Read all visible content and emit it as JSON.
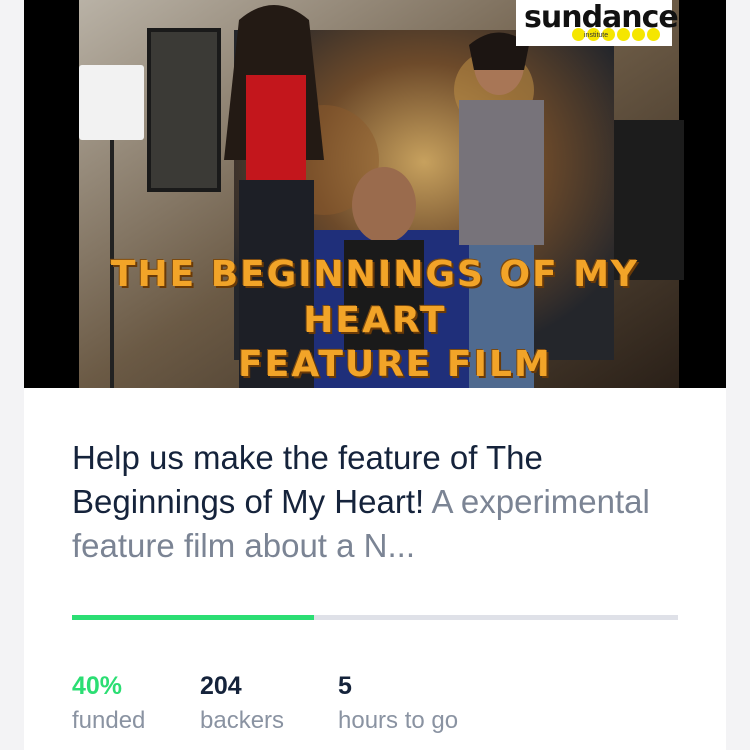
{
  "hero": {
    "title_lines": [
      "THE BEGINNINGS OF MY",
      "HEART",
      "FEATURE FILM"
    ],
    "logo": {
      "word": "sundance",
      "sub": "institute"
    }
  },
  "project": {
    "title": "Help us make the feature of The Beginnings of My Heart!",
    "blurb": "A experimental feature film about a N..."
  },
  "progress": {
    "fraction": 0.4,
    "fill_color": "#2bde73"
  },
  "stats": [
    {
      "value": "40%",
      "label": "funded"
    },
    {
      "value": "204",
      "label": "backers"
    },
    {
      "value": "5",
      "label": "hours to go"
    }
  ]
}
